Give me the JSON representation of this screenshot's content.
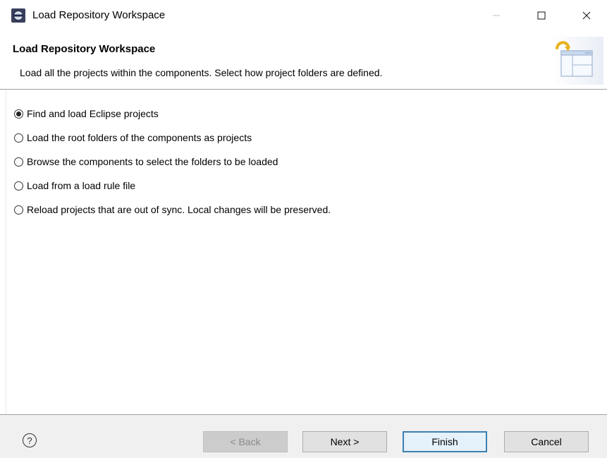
{
  "window": {
    "title": "Load Repository Workspace",
    "icons": {
      "app": "eclipse-icon",
      "minimize": "minimize-icon",
      "maximize": "maximize-icon",
      "close": "close-icon"
    }
  },
  "header": {
    "title": "Load Repository Workspace",
    "description": "Load all the projects within the components. Select how project folders are defined.",
    "image_icon": "load-workspace-wizard-icon"
  },
  "options": [
    {
      "label": "Find and load Eclipse projects",
      "selected": true
    },
    {
      "label": "Load the root folders of the components as projects",
      "selected": false
    },
    {
      "label": "Browse the components to select the folders to be loaded",
      "selected": false
    },
    {
      "label": "Load from a load rule file",
      "selected": false
    },
    {
      "label": "Reload projects that are out of sync. Local changes will be preserved.",
      "selected": false
    }
  ],
  "buttons": {
    "help": "?",
    "back": "< Back",
    "next": "Next >",
    "finish": "Finish",
    "cancel": "Cancel"
  },
  "colors": {
    "default_button_border": "#3c7fb1",
    "button_bg": "#e1e1e1",
    "bottom_bar_bg": "#f0f0f0"
  }
}
